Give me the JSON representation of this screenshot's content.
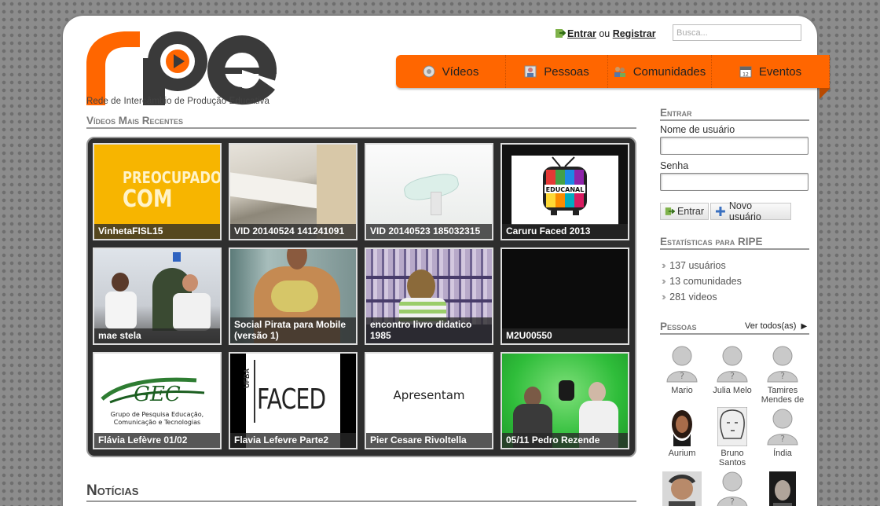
{
  "brand": {
    "name": "ripe",
    "tagline": "Rede de Intercâmbio de Produção Educativa"
  },
  "topbar": {
    "login_label": "Entrar",
    "or_label": "ou",
    "register_label": "Registrar",
    "search_placeholder": "Busca..."
  },
  "nav": {
    "items": [
      {
        "label": "Vídeos",
        "icon": "video-icon"
      },
      {
        "label": "Pessoas",
        "icon": "person-icon"
      },
      {
        "label": "Comunidades",
        "icon": "community-icon"
      },
      {
        "label": "Eventos",
        "icon": "calendar-icon"
      }
    ]
  },
  "videos": {
    "heading": "Vídeos Mais Recentes",
    "items": [
      {
        "title": "VinhetaFISL15",
        "overlay_lines": [
          "PREOCUPADO",
          "COM"
        ]
      },
      {
        "title": "VID 20140524 141241091"
      },
      {
        "title": "VID 20140523 185032315"
      },
      {
        "title": "Caruru Faced 2013",
        "overlay_lines": [
          "EDUCANAL"
        ]
      },
      {
        "title": "mae stela"
      },
      {
        "title": "Social Pirata para Mobile (versão 1)"
      },
      {
        "title": "encontro livro didatico 1985"
      },
      {
        "title": "M2U00550"
      },
      {
        "title": "Flávia Lefèvre 01/02",
        "overlay_lines": [
          "GEC",
          "Grupo de Pesquisa Educação,",
          "Comunicação e Tecnologias"
        ]
      },
      {
        "title": "Flavia Lefevre Parte2",
        "overlay_lines": [
          "UFBA",
          "FACED"
        ]
      },
      {
        "title": "Pier Cesare Rivoltella",
        "overlay_lines": [
          "Apresentam"
        ]
      },
      {
        "title": "05/11 Pedro Rezende"
      }
    ]
  },
  "news": {
    "heading": "Notícias"
  },
  "login": {
    "heading": "Entrar",
    "username_label": "Nome de usuário",
    "password_label": "Senha",
    "submit_label": "Entrar",
    "new_user_label": "Novo usuário"
  },
  "stats": {
    "heading": "Estatísticas para RIPE",
    "items": [
      "137 usuários",
      "13 comunidades",
      "281 videos"
    ]
  },
  "people": {
    "heading": "Pessoas",
    "see_all_label": "Ver todos(as)",
    "items": [
      {
        "name": "Mario",
        "avatar": "default"
      },
      {
        "name": "Julia Melo",
        "avatar": "default"
      },
      {
        "name": "Tamires Mendes de",
        "avatar": "default"
      },
      {
        "name": "Aurium",
        "avatar": "photo"
      },
      {
        "name": "Bruno Santos",
        "avatar": "drawing"
      },
      {
        "name": "Índia",
        "avatar": "default"
      },
      {
        "name": "",
        "avatar": "photo"
      },
      {
        "name": "",
        "avatar": "default"
      },
      {
        "name": "",
        "avatar": "photo"
      }
    ]
  },
  "colors": {
    "accent": "#ff6600",
    "heading": "#7a7a7a",
    "video_bg": "#2e2e2e"
  }
}
